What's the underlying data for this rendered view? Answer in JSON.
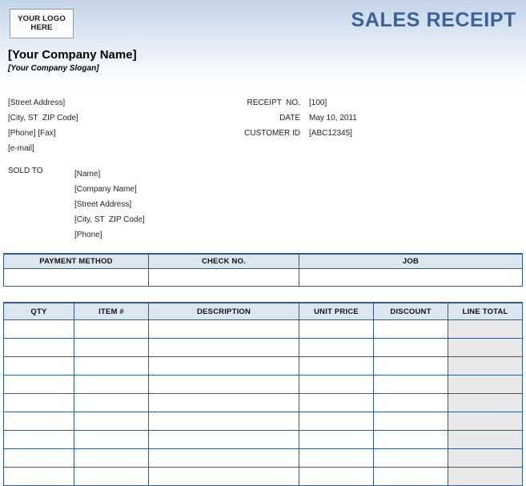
{
  "header": {
    "logo_line1": "YOUR LOGO",
    "logo_line2": "HERE",
    "document_title": "SALES RECEIPT",
    "title_color": "#3a6298",
    "company_name": "[Your Company Name]",
    "company_slogan": "[Your Company Slogan]"
  },
  "company_address": {
    "lines": [
      "[Street Address]",
      "[City, ST  ZIP Code]",
      "[Phone] [Fax]",
      "[e-mail]"
    ]
  },
  "receipt_meta": {
    "rows": [
      {
        "label": "RECEIPT  NO.",
        "value": "[100]"
      },
      {
        "label": "DATE",
        "value": "May 10, 2011"
      },
      {
        "label": "CUSTOMER ID",
        "value": "[ABC12345]"
      }
    ]
  },
  "sold_to": {
    "label": "SOLD TO",
    "lines": [
      "[Name]",
      "[Company Name]",
      "[Street Address]",
      "[City, ST  ZIP Code]",
      "[Phone]"
    ]
  },
  "payment_table": {
    "headers": [
      "PAYMENT METHOD",
      "CHECK NO.",
      "JOB"
    ],
    "rows": [
      [
        "",
        "",
        ""
      ]
    ]
  },
  "items_table": {
    "headers": [
      "QTY",
      "ITEM #",
      "DESCRIPTION",
      "UNIT PRICE",
      "DISCOUNT",
      "LINE TOTAL"
    ],
    "rows": [
      [
        "",
        "",
        "",
        "",
        "",
        ""
      ],
      [
        "",
        "",
        "",
        "",
        "",
        ""
      ],
      [
        "",
        "",
        "",
        "",
        "",
        ""
      ],
      [
        "",
        "",
        "",
        "",
        "",
        ""
      ],
      [
        "",
        "",
        "",
        "",
        "",
        ""
      ],
      [
        "",
        "",
        "",
        "",
        "",
        ""
      ],
      [
        "",
        "",
        "",
        "",
        "",
        ""
      ],
      [
        "",
        "",
        "",
        "",
        "",
        ""
      ],
      [
        "",
        "",
        "",
        "",
        "",
        ""
      ]
    ]
  },
  "colors": {
    "header_gradient_top": "#c3d4e8",
    "table_border": "#2e5b96",
    "table_header_fill": "#dce6f1",
    "line_total_fill": "#e8e8e8"
  }
}
